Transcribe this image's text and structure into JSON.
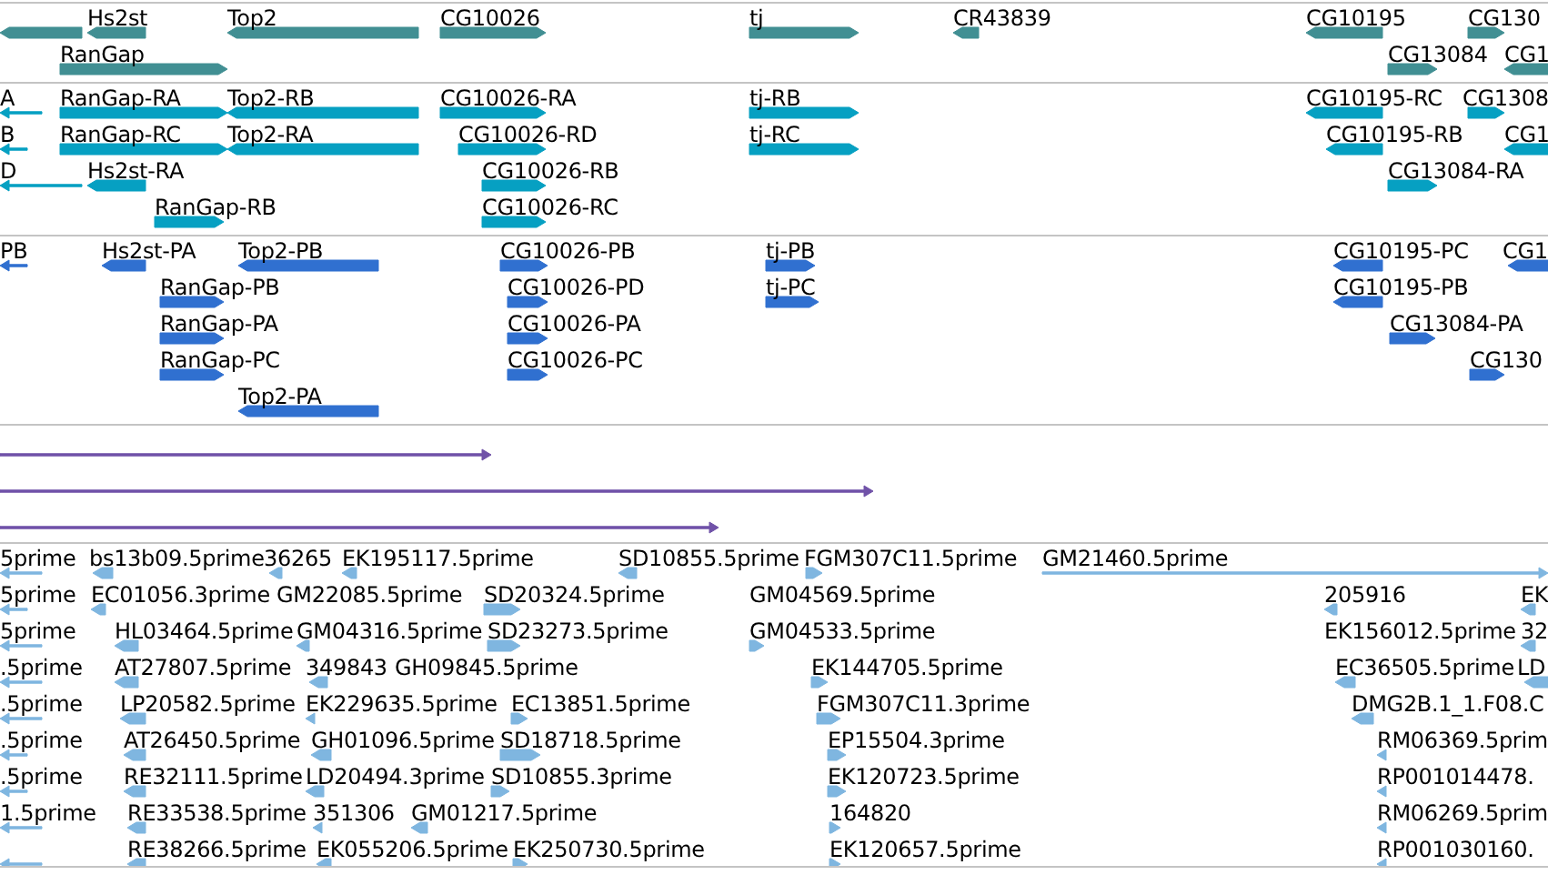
{
  "tracks": [
    {
      "color": "#418f93",
      "features": [
        {
          "reverse": true
        },
        {
          "label": "Hs2st",
          "reverse": true
        },
        {
          "label": "Top2",
          "reverse": true
        },
        {
          "label": "CG10026",
          "reverse": false
        },
        {
          "label": "tj",
          "reverse": false
        },
        {
          "label": "CR43839",
          "reverse": true
        },
        {
          "label": "CG10195",
          "reverse": true
        },
        {
          "label": "CG130",
          "reverse": false
        },
        {
          "label": "RanGap",
          "reverse": false
        },
        {
          "label": "CG13084",
          "reverse": false
        },
        {
          "label": "CG1",
          "reverse": true
        }
      ]
    },
    {
      "color": "#06a0c2",
      "features": [
        {
          "label": "A",
          "reverse": true
        },
        {
          "label": "RanGap-RA",
          "reverse": false
        },
        {
          "label": "Top2-RB",
          "reverse": true
        },
        {
          "label": "CG10026-RA",
          "reverse": false
        },
        {
          "label": "tj-RB",
          "reverse": false
        },
        {
          "label": "CG10195-RC",
          "reverse": true
        },
        {
          "label": "CG1308",
          "reverse": false
        },
        {
          "label": "B",
          "reverse": true
        },
        {
          "label": "RanGap-RC",
          "reverse": false
        },
        {
          "label": "Top2-RA",
          "reverse": true
        },
        {
          "label": "CG10026-RD",
          "reverse": false
        },
        {
          "label": "tj-RC",
          "reverse": false
        },
        {
          "label": "CG10195-RB",
          "reverse": true
        },
        {
          "label": "CG1",
          "reverse": true
        },
        {
          "label": "D",
          "reverse": true
        },
        {
          "label": "Hs2st-RA",
          "reverse": true
        },
        {
          "label": "CG10026-RB",
          "reverse": false
        },
        {
          "label": "CG13084-RA",
          "reverse": false
        },
        {
          "label": "RanGap-RB",
          "reverse": false
        },
        {
          "label": "CG10026-RC",
          "reverse": false
        }
      ]
    },
    {
      "color": "#3070d0",
      "features": [
        {
          "label": "PB",
          "reverse": true
        },
        {
          "label": "Hs2st-PA",
          "reverse": true
        },
        {
          "label": "Top2-PB",
          "reverse": true
        },
        {
          "label": "CG10026-PB",
          "reverse": false
        },
        {
          "label": "tj-PB",
          "reverse": false
        },
        {
          "label": "CG10195-PC",
          "reverse": true
        },
        {
          "label": "CG1",
          "reverse": true
        },
        {
          "label": "RanGap-PB",
          "reverse": false
        },
        {
          "label": "CG10026-PD",
          "reverse": false
        },
        {
          "label": "tj-PC",
          "reverse": false
        },
        {
          "label": "CG10195-PB",
          "reverse": true
        },
        {
          "label": "RanGap-PA",
          "reverse": false
        },
        {
          "label": "CG10026-PA",
          "reverse": false
        },
        {
          "label": "CG13084-PA",
          "reverse": false
        },
        {
          "label": "RanGap-PC",
          "reverse": false
        },
        {
          "label": "CG10026-PC",
          "reverse": false
        },
        {
          "label": "CG130",
          "reverse": false
        },
        {
          "label": "Top2-PA",
          "reverse": true
        }
      ]
    },
    {
      "color": "#7052a8",
      "features": [
        {
          "reverse": false
        },
        {
          "reverse": false
        },
        {
          "reverse": false
        }
      ]
    },
    {
      "color": "#7fb6e0",
      "features": [
        {
          "label": "5prime",
          "reverse": true
        },
        {
          "label": "bs13b09.5prime",
          "reverse": true
        },
        {
          "label": "36265",
          "reverse": true
        },
        {
          "label": "EK195117.5prime",
          "reverse": true
        },
        {
          "label": "SD10855.5prime",
          "reverse": true
        },
        {
          "label": "FGM307C11.5prime",
          "reverse": false
        },
        {
          "label": "GM21460.5prime",
          "reverse": false
        },
        {
          "label": "5prime",
          "reverse": true
        },
        {
          "label": "EC01056.3prime",
          "reverse": true
        },
        {
          "label": "GM22085.5prime"
        },
        {
          "label": "SD20324.5prime",
          "reverse": false
        },
        {
          "label": "GM04569.5prime"
        },
        {
          "label": "205916",
          "reverse": true
        },
        {
          "label": "EK",
          "reverse": true
        },
        {
          "label": "5prime",
          "reverse": true
        },
        {
          "label": "HL03464.5prime",
          "reverse": true
        },
        {
          "label": "GM04316.5prime",
          "reverse": true
        },
        {
          "label": "SD23273.5prime",
          "reverse": false
        },
        {
          "label": "GM04533.5prime",
          "reverse": false
        },
        {
          "label": "EK156012.5prime"
        },
        {
          "label": "32",
          "reverse": true
        },
        {
          "label": ".5prime",
          "reverse": true
        },
        {
          "label": "AT27807.5prime",
          "reverse": true
        },
        {
          "label": "349843",
          "reverse": true
        },
        {
          "label": "GH09845.5prime"
        },
        {
          "label": "EK144705.5prime",
          "reverse": false
        },
        {
          "label": "EC36505.5prime",
          "reverse": true
        },
        {
          "label": "LD",
          "reverse": true
        },
        {
          "label": ".5prime",
          "reverse": true
        },
        {
          "label": "LP20582.5prime",
          "reverse": true
        },
        {
          "label": "EK229635.5prime",
          "reverse": true
        },
        {
          "label": "EC13851.5prime",
          "reverse": false
        },
        {
          "label": "FGM307C11.3prime",
          "reverse": false
        },
        {
          "label": "DMG2B.1_1.F08.C",
          "reverse": true
        },
        {
          "label": ".5prime",
          "reverse": true
        },
        {
          "label": "AT26450.5prime",
          "reverse": true
        },
        {
          "label": "GH01096.5prime",
          "reverse": true
        },
        {
          "label": "SD18718.5prime",
          "reverse": false
        },
        {
          "label": "EP15504.3prime",
          "reverse": false
        },
        {
          "label": "RM06369.5prim",
          "reverse": true
        },
        {
          "label": ".5prime",
          "reverse": true
        },
        {
          "label": "RE32111.5prime",
          "reverse": true
        },
        {
          "label": "LD20494.3prime",
          "reverse": true
        },
        {
          "label": "SD10855.3prime",
          "reverse": false
        },
        {
          "label": "EK120723.5prime",
          "reverse": false
        },
        {
          "label": "RP001014478.",
          "reverse": true
        },
        {
          "label": "1.5prime",
          "reverse": true
        },
        {
          "label": "RE33538.5prime",
          "reverse": true
        },
        {
          "label": "351306",
          "reverse": true
        },
        {
          "label": "GM01217.5prime",
          "reverse": true
        },
        {
          "label": "164820",
          "reverse": false
        },
        {
          "label": "RM06269.5prim",
          "reverse": true
        },
        {
          "reverse": true
        },
        {
          "label": "RE38266.5prime",
          "reverse": true
        },
        {
          "label": "EK055206.5prime",
          "reverse": true
        },
        {
          "label": "EK250730.5prime",
          "reverse": false
        },
        {
          "label": "EK120657.5prime",
          "reverse": false
        },
        {
          "label": "RP001030160.",
          "reverse": true
        }
      ]
    }
  ]
}
